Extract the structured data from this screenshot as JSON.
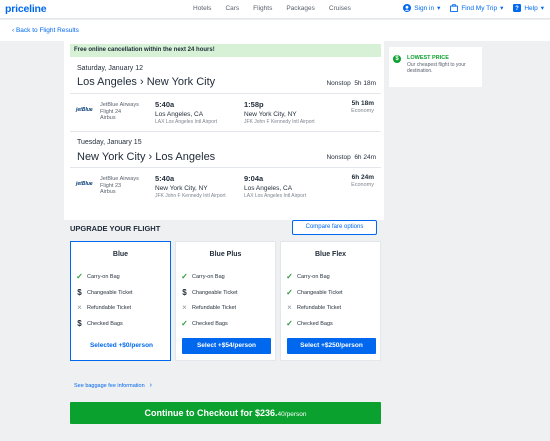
{
  "header": {
    "logo": "priceline",
    "nav": [
      "Hotels",
      "Cars",
      "Flights",
      "Packages",
      "Cruises"
    ],
    "sign_in": "Sign in",
    "find_trip": "Find My Trip",
    "help": "Help"
  },
  "back_link": "‹ Back to Flight Results",
  "banner": "Free online cancellation within the next 24 hours!",
  "slices": [
    {
      "date": "Saturday, January 12",
      "route": "Los Angeles › New York City",
      "stops": "Nonstop",
      "duration": "5h 18m",
      "airline_logo": "jetBlue",
      "airline": "JetBlue Airways",
      "flight": "Flight 24",
      "aircraft": "Airbus",
      "dep_time": "5:40a",
      "dep_city": "Los Angeles, CA",
      "dep_airport": "LAX Los Angeles Intl Airport",
      "arr_time": "1:58p",
      "arr_city": "New York City, NY",
      "arr_airport": "JFK John F Kennedy Intl Airport",
      "seg_duration": "5h 18m",
      "cabin": "Economy"
    },
    {
      "date": "Tuesday, January 15",
      "route": "New York City › Los Angeles",
      "stops": "Nonstop",
      "duration": "6h 24m",
      "airline_logo": "jetBlue",
      "airline": "JetBlue Airways",
      "flight": "Flight 23",
      "aircraft": "Airbus",
      "dep_time": "5:40a",
      "dep_city": "New York City, NY",
      "dep_airport": "JFK John F Kennedy Intl Airport",
      "arr_time": "9:04a",
      "arr_city": "Los Angeles, CA",
      "arr_airport": "LAX Los Angeles Intl Airport",
      "seg_duration": "6h 24m",
      "cabin": "Economy"
    }
  ],
  "upgrade": {
    "title": "UPGRADE YOUR FLIGHT",
    "compare": "Compare fare options",
    "fares": [
      {
        "name": "Blue",
        "features": [
          {
            "icon": "check",
            "label": "Carry-on Bag"
          },
          {
            "icon": "dollar",
            "label": "Changeable Ticket"
          },
          {
            "icon": "cross",
            "label": "Refundable Ticket"
          },
          {
            "icon": "dollar",
            "label": "Checked Bags"
          }
        ],
        "button": "Selected +$0/person"
      },
      {
        "name": "Blue Plus",
        "features": [
          {
            "icon": "check",
            "label": "Carry-on Bag"
          },
          {
            "icon": "dollar",
            "label": "Changeable Ticket"
          },
          {
            "icon": "cross",
            "label": "Refundable Ticket"
          },
          {
            "icon": "check",
            "label": "Checked Bags"
          }
        ],
        "button": "Select +$54/person"
      },
      {
        "name": "Blue Flex",
        "features": [
          {
            "icon": "check",
            "label": "Carry-on Bag"
          },
          {
            "icon": "check",
            "label": "Changeable Ticket"
          },
          {
            "icon": "cross",
            "label": "Refundable Ticket"
          },
          {
            "icon": "check",
            "label": "Checked Bags"
          }
        ],
        "button": "Select +$250/person"
      }
    ]
  },
  "baggage_link": "See baggage fee information",
  "checkout": {
    "label": "Continue to Checkout for $236.",
    "cents": "40",
    "per": "/person"
  },
  "lowest_price": {
    "title": "LOWEST PRICE",
    "desc": "Our cheapest flight to your destination."
  },
  "colors": {
    "brand_blue": "#0068ef",
    "checkout_green": "#0aa12e",
    "banner_green": "#d6f1d5"
  }
}
